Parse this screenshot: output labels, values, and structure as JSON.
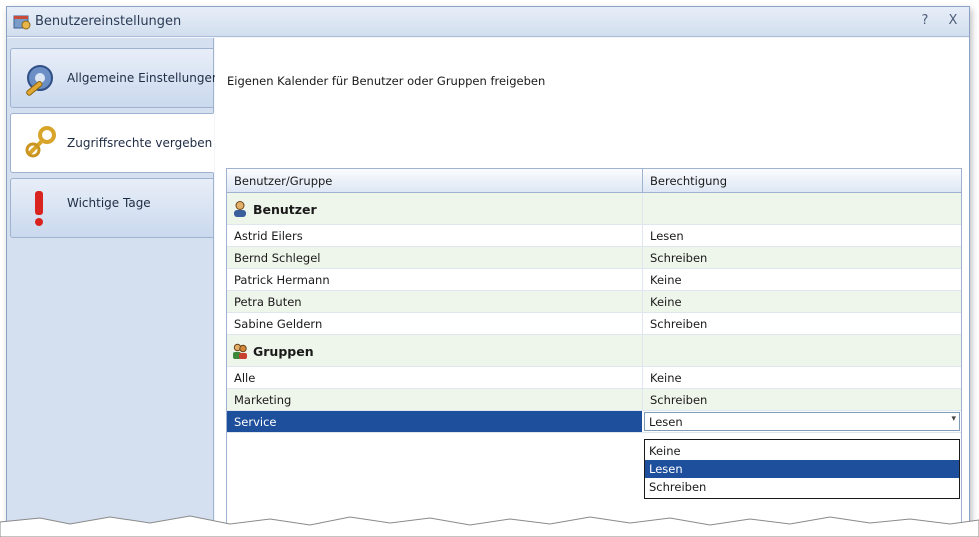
{
  "window": {
    "title": "Benutzereinstellungen",
    "help": "?",
    "close": "X"
  },
  "sidebar": {
    "items": [
      {
        "label": "Allgemeine Einstellungen",
        "icon": "gear-wrench-icon"
      },
      {
        "label": "Zugriffsrechte vergeben",
        "icon": "keys-icon"
      },
      {
        "label": "Wichtige Tage",
        "icon": "exclamation-icon"
      }
    ]
  },
  "content": {
    "heading": "Eigenen Kalender für Benutzer oder Gruppen freigeben"
  },
  "grid": {
    "columns": [
      "Benutzer/Gruppe",
      "Berechtigung"
    ],
    "groups": [
      {
        "name": "Benutzer",
        "icon": "user-icon",
        "rows": [
          {
            "name": "Astrid Eilers",
            "permission": "Lesen"
          },
          {
            "name": "Bernd Schlegel",
            "permission": "Schreiben"
          },
          {
            "name": "Patrick Hermann",
            "permission": "Keine"
          },
          {
            "name": "Petra Buten",
            "permission": "Keine"
          },
          {
            "name": "Sabine Geldern",
            "permission": "Schreiben"
          }
        ]
      },
      {
        "name": "Gruppen",
        "icon": "group-icon",
        "rows": [
          {
            "name": "Alle",
            "permission": "Keine"
          },
          {
            "name": "Marketing",
            "permission": "Schreiben"
          },
          {
            "name": "Service",
            "permission": "Lesen"
          }
        ]
      }
    ],
    "dropdown": {
      "options": [
        "Keine",
        "Lesen",
        "Schreiben"
      ],
      "selected": "Lesen"
    }
  },
  "colors": {
    "selection": "#1e4f9c",
    "sidebar": "#d4dff0",
    "row_alt": "#eef5ea"
  }
}
